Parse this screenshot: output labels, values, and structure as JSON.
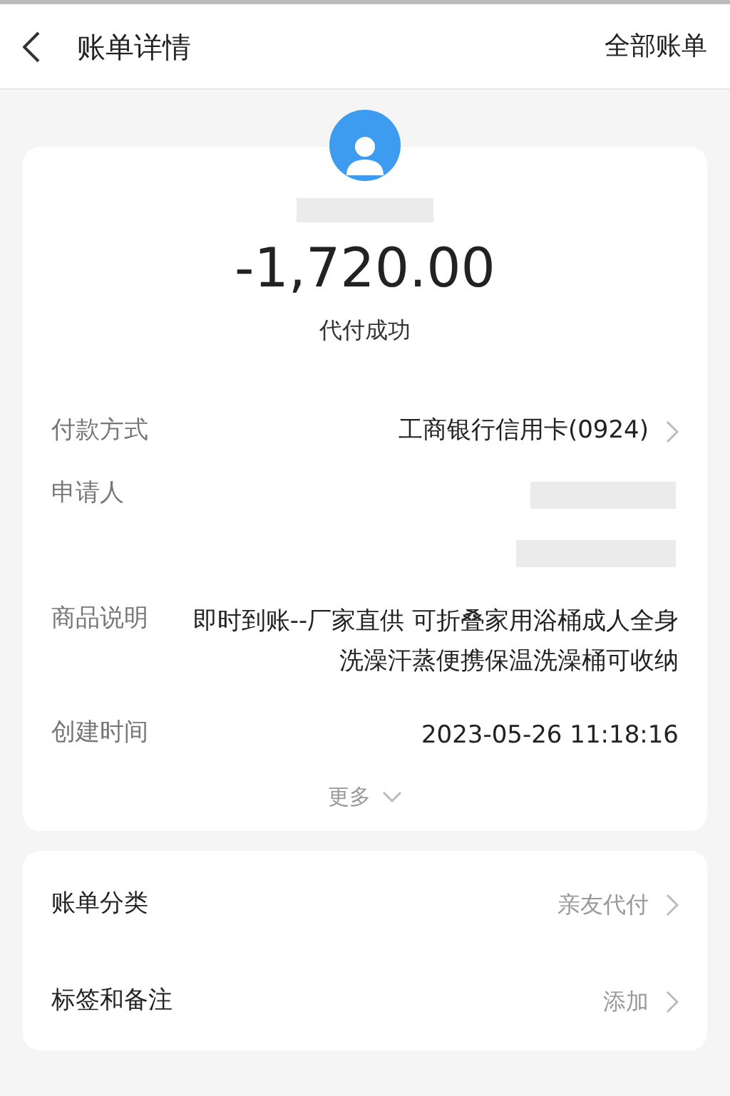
{
  "header": {
    "title": "账单详情",
    "action": "全部账单"
  },
  "summary": {
    "amount": "-1,720.00",
    "status": "代付成功"
  },
  "details": [
    {
      "kind": "link",
      "label": "付款方式",
      "value": "工商银行信用卡(0924)"
    },
    {
      "kind": "redacted",
      "label": "申请人"
    },
    {
      "kind": "text",
      "label": "商品说明",
      "value": "即时到账--厂家直供 可折叠家用浴桶成人全身洗澡汗蒸便携保温洗澡桶可收纳"
    },
    {
      "kind": "text",
      "label": "创建时间",
      "value": "2023-05-26 11:18:16"
    }
  ],
  "more": "更多",
  "settings": [
    {
      "label": "账单分类",
      "value": "亲友代付"
    },
    {
      "label": "标签和备注",
      "value": "添加"
    }
  ]
}
